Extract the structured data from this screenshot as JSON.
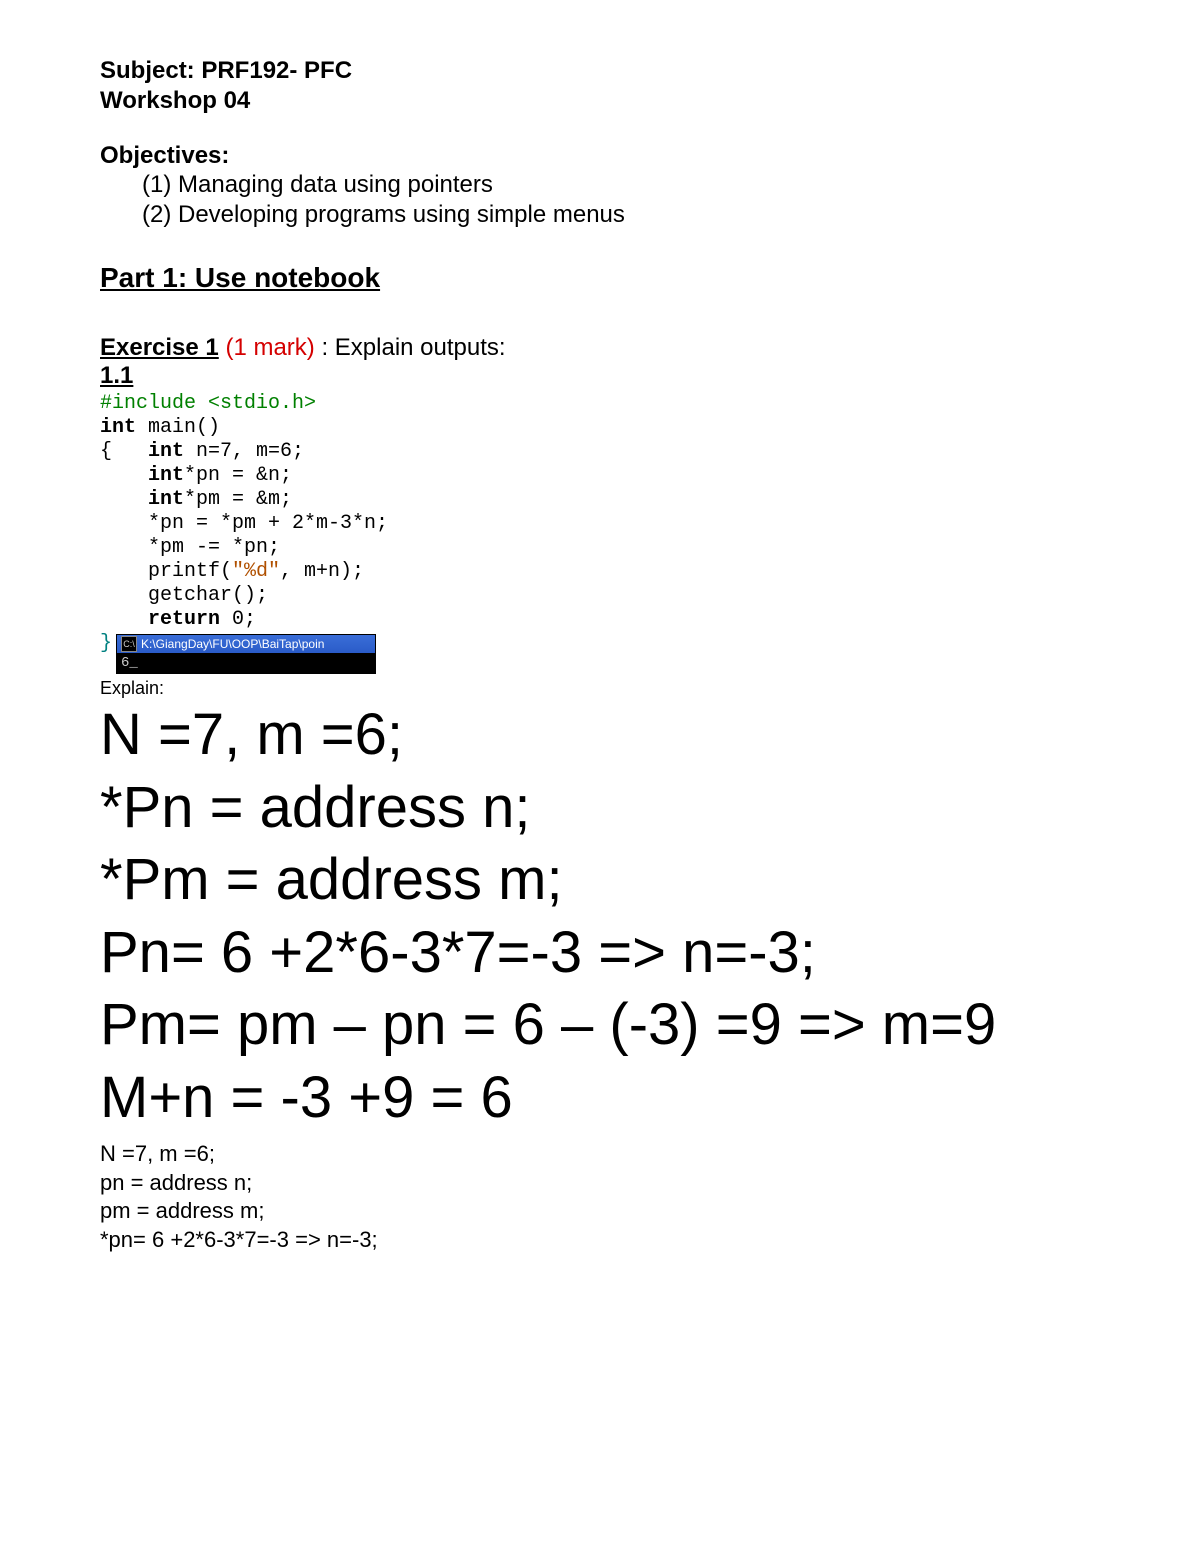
{
  "header": {
    "subject": "Subject: PRF192- PFC",
    "workshop": "Workshop 04"
  },
  "objectives": {
    "title": "Objectives:",
    "items": [
      "(1) Managing data using pointers",
      "(2) Developing programs using simple menus"
    ]
  },
  "part1": {
    "title": "Part 1: Use notebook"
  },
  "exercise1": {
    "label": "Exercise 1",
    "mark": " (1 mark)",
    "tail": " : Explain outputs:",
    "sub": "1.1"
  },
  "code": {
    "include": "#include <stdio.h>",
    "l2a": "int",
    "l2b": " main()",
    "l3a": "{   ",
    "l3b": "int",
    "l3c": " n=7, m=6;",
    "l4a": "    ",
    "l4b": "int",
    "l4c": "*pn = &n;",
    "l5a": "    ",
    "l5b": "int",
    "l5c": "*pm = &m;",
    "l6": "    *pn = *pm + 2*m-3*n;",
    "l7": "    *pm -= *pn;",
    "l8a": "    printf(",
    "l8b": "\"%d\"",
    "l8c": ", m+n);",
    "l9": "    getchar();",
    "l10a": "    ",
    "l10b": "return",
    "l10c": " 0;",
    "l11": "}"
  },
  "console": {
    "icon": "C:\\",
    "title": "K:\\GiangDay\\FU\\OOP\\BaiTap\\poin",
    "output": "6_"
  },
  "explain": {
    "label": "Explain:",
    "big": [
      "N =7, m =6;",
      "*Pn = address n;",
      "*Pm = address m;",
      "Pn= 6 +2*6-3*7=-3 => n=-3;",
      "Pm= pm – pn = 6 – (-3) =9 => m=9",
      "M+n = -3 +9 = 6"
    ],
    "small": [
      "N =7, m =6;",
      "pn = address n;",
      "pm = address m;",
      "*pn= 6 +2*6-3*7=-3 => n=-3;"
    ]
  }
}
